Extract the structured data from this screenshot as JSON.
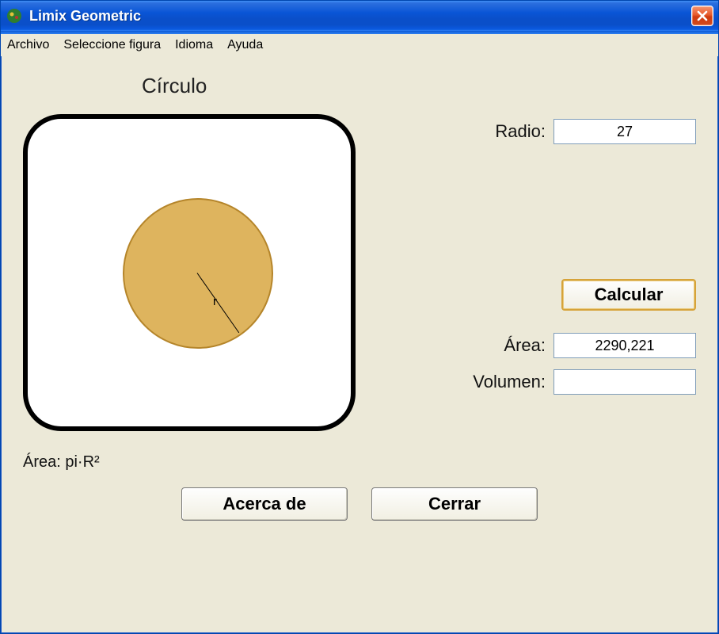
{
  "window": {
    "title": "Limix Geometric"
  },
  "menu": {
    "archivo": "Archivo",
    "seleccione": "Seleccione figura",
    "idioma": "Idioma",
    "ayuda": "Ayuda"
  },
  "shape": {
    "title": "Círculo",
    "radius_letter": "r",
    "formula": "Área: pi·R²"
  },
  "inputs": {
    "radio_label": "Radio:",
    "radio_value": "27",
    "area_label": "Área:",
    "area_value": "2290,221",
    "volumen_label": "Volumen:",
    "volumen_value": ""
  },
  "buttons": {
    "calcular": "Calcular",
    "acerca": "Acerca de",
    "cerrar": "Cerrar"
  }
}
